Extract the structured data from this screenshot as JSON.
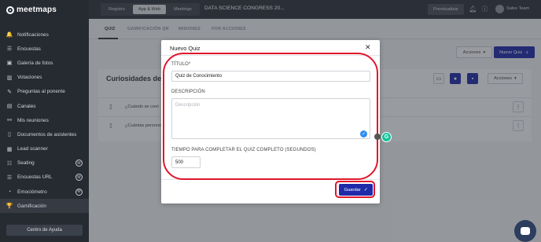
{
  "app": {
    "logo_text": "meetmaps"
  },
  "sidebar": {
    "items": [
      {
        "label": "Notificaciones",
        "icon": "bell-icon",
        "glyph": "🔔"
      },
      {
        "label": "Encuestas",
        "icon": "list-icon",
        "glyph": "☰"
      },
      {
        "label": "Galería de fotos",
        "icon": "image-icon",
        "glyph": "▣"
      },
      {
        "label": "Votaciones",
        "icon": "chart-icon",
        "glyph": "▥"
      },
      {
        "label": "Preguntas al ponente",
        "icon": "question-icon",
        "glyph": "✎"
      },
      {
        "label": "Canales",
        "icon": "channel-icon",
        "glyph": "▤"
      },
      {
        "label": "Mis reuniones",
        "icon": "meetings-icon",
        "glyph": "⚯"
      },
      {
        "label": "Documentos de asistentes",
        "icon": "document-icon",
        "glyph": "▯"
      },
      {
        "label": "Lead scanner",
        "icon": "qr-icon",
        "glyph": "▦"
      },
      {
        "label": "Seating",
        "icon": "seating-icon",
        "glyph": "☷",
        "badge": "M"
      },
      {
        "label": "Encuestas URL",
        "icon": "list-icon",
        "glyph": "☰",
        "badge": "M"
      },
      {
        "label": "Emociómetro",
        "icon": "emotion-icon",
        "glyph": "◔",
        "badge": "M"
      },
      {
        "label": "Gamificación",
        "icon": "trophy-icon",
        "glyph": "🏆"
      }
    ],
    "help_label": "Centro de Ayuda"
  },
  "topbar": {
    "tabs": [
      "Registro",
      "App & Web",
      "Meetings"
    ],
    "active_tab": "App & Web",
    "event_title": "DATA SCIENCE CONGRESS 20...",
    "preview_label": "Previsualizar",
    "user_name": "Sales Team"
  },
  "subtabs": [
    "QUIZ",
    "GAMIFICACIÓN QR",
    "MISIONES",
    "POR ACCIONES"
  ],
  "toolbar": {
    "acciones_label": "Acciones",
    "nuevo_label": "Nuevo Quiz"
  },
  "panel": {
    "title": "Curiosidades del E",
    "acciones_label": "Acciones",
    "rows": [
      {
        "text": "¿Cuándo se creó"
      },
      {
        "text": "¿Cuántas persono"
      }
    ]
  },
  "modal": {
    "title": "Nuevo Quiz",
    "titulo_label": "TÍTULO*",
    "titulo_value": "Quiz de Conocimiento",
    "descripcion_label": "DESCRIPCIÓN",
    "descripcion_placeholder": "Descripción",
    "tiempo_label": "TIEMPO PARA COMPLETAR EL QUIZ COMPLETO (SEGUNDOS)",
    "tiempo_value": "500",
    "save_label": "Guardar"
  },
  "colors": {
    "primary": "#1f2aa8",
    "annotation": "#e0162b",
    "sidebar_bg": "#262a31"
  }
}
